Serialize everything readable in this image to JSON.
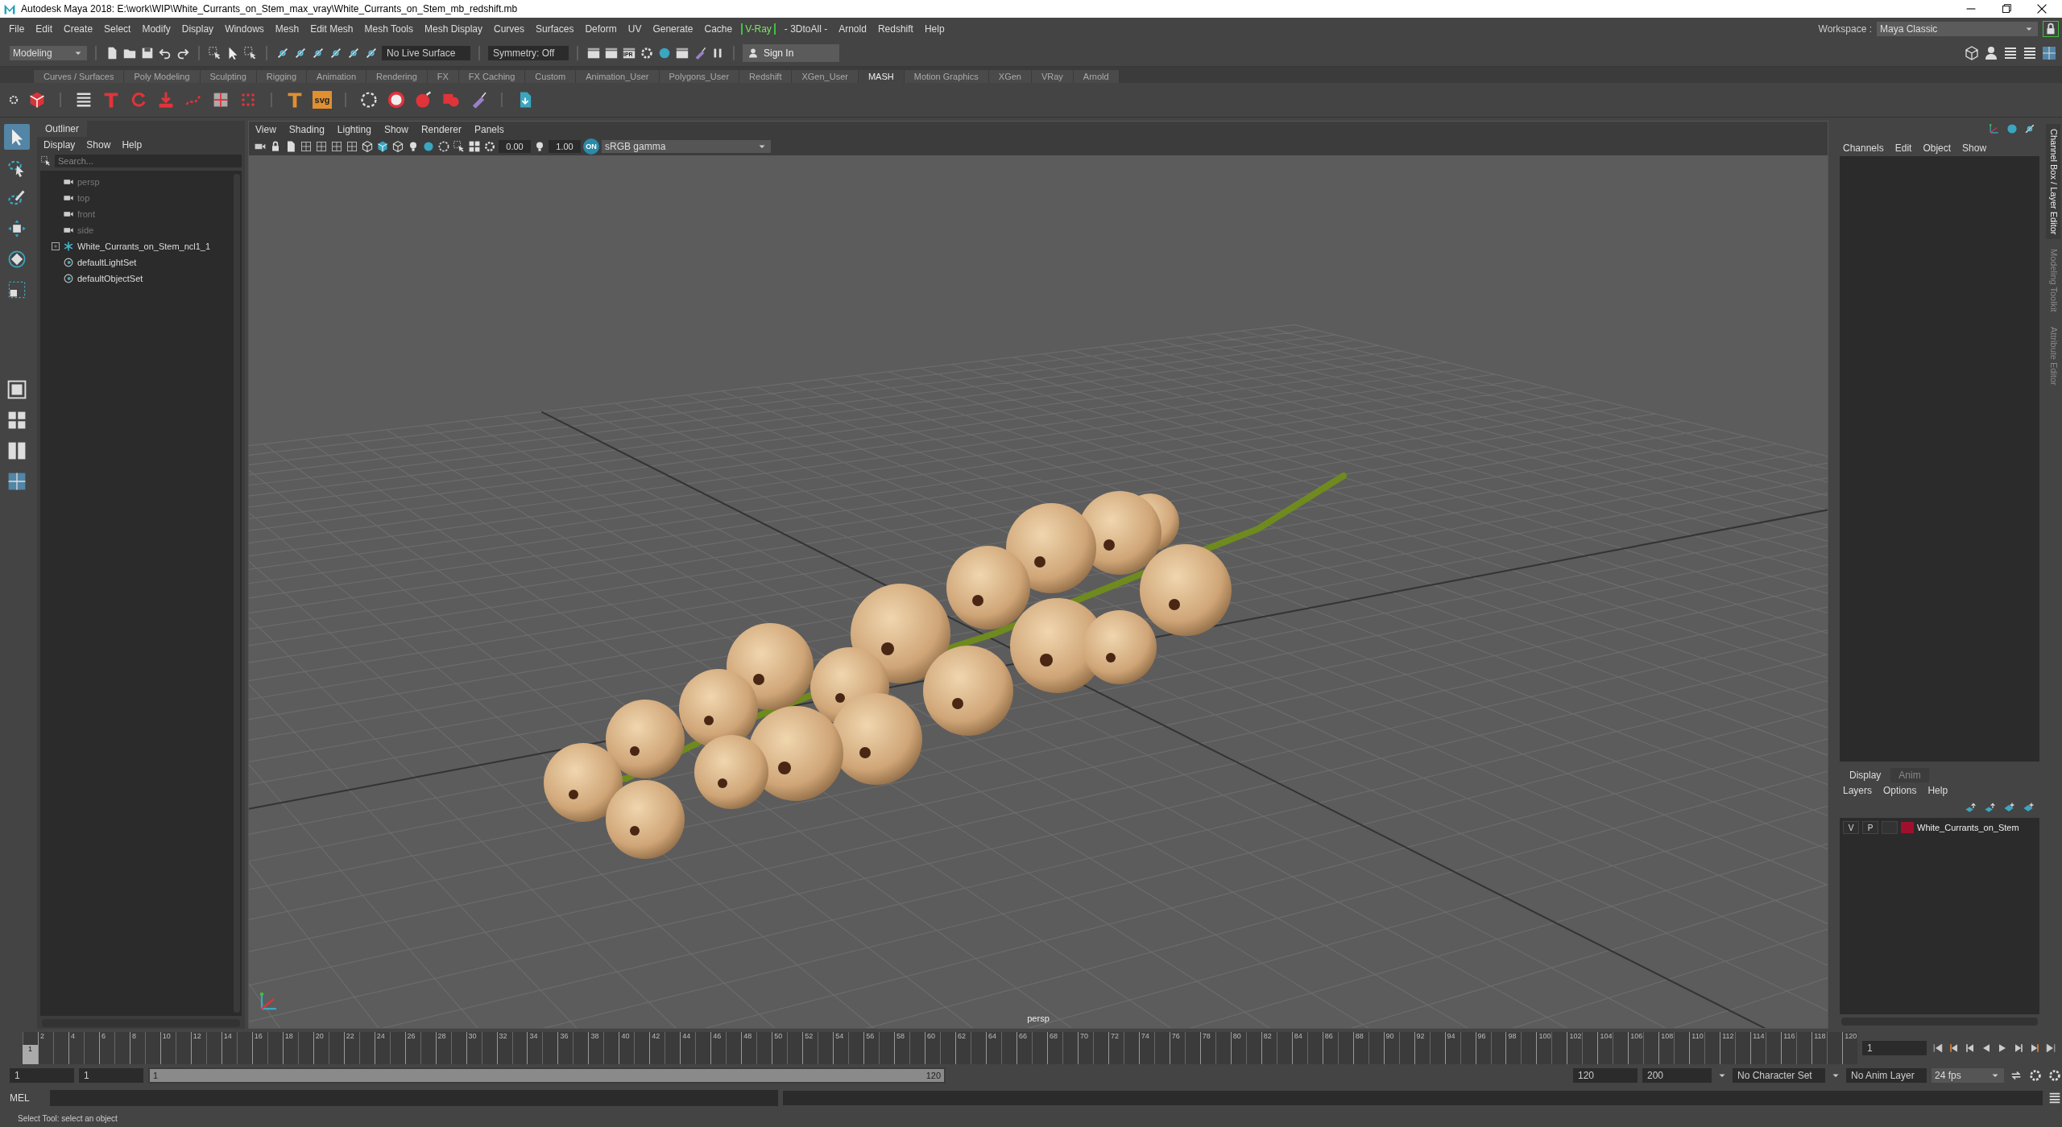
{
  "window": {
    "title": "Autodesk Maya 2018: E:\\work\\WIP\\White_Currants_on_Stem_max_vray\\White_Currants_on_Stem_mb_redshift.mb"
  },
  "menu_bar": {
    "items": [
      {
        "label": "File",
        "kind": "plain"
      },
      {
        "label": "Edit",
        "kind": "plain"
      },
      {
        "label": "Create",
        "kind": "plain"
      },
      {
        "label": "Select",
        "kind": "plain"
      },
      {
        "label": "Modify",
        "kind": "plain"
      },
      {
        "label": "Display",
        "kind": "plain"
      },
      {
        "label": "Windows",
        "kind": "plain"
      },
      {
        "label": "Mesh",
        "kind": "plain"
      },
      {
        "label": "Edit Mesh",
        "kind": "plain"
      },
      {
        "label": "Mesh Tools",
        "kind": "plain"
      },
      {
        "label": "Mesh Display",
        "kind": "plain"
      },
      {
        "label": "Curves",
        "kind": "plain"
      },
      {
        "label": "Surfaces",
        "kind": "plain"
      },
      {
        "label": "Deform",
        "kind": "plain"
      },
      {
        "label": "UV",
        "kind": "plain"
      },
      {
        "label": "Generate",
        "kind": "plain"
      },
      {
        "label": "Cache",
        "kind": "plain"
      },
      {
        "label": "V-Ray",
        "kind": "boxed"
      },
      {
        "label": "- 3DtoAll -",
        "kind": "plain"
      },
      {
        "label": "Arnold",
        "kind": "plain"
      },
      {
        "label": "Redshift",
        "kind": "plain"
      },
      {
        "label": "Help",
        "kind": "plain"
      }
    ],
    "workspace_label": "Workspace :",
    "workspace_value": "Maya Classic"
  },
  "status_line": {
    "mode": "Modeling",
    "live_surface": "No Live Surface",
    "symmetry": "Symmetry: Off",
    "ipr_label": "IPR",
    "sign_in": "Sign In"
  },
  "shelf": {
    "tabs": [
      {
        "label": "Curves / Surfaces",
        "selected": false
      },
      {
        "label": "Poly Modeling",
        "selected": false
      },
      {
        "label": "Sculpting",
        "selected": false
      },
      {
        "label": "Rigging",
        "selected": false
      },
      {
        "label": "Animation",
        "selected": false
      },
      {
        "label": "Rendering",
        "selected": false
      },
      {
        "label": "FX",
        "selected": false
      },
      {
        "label": "FX Caching",
        "selected": false
      },
      {
        "label": "Custom",
        "selected": false
      },
      {
        "label": "Animation_User",
        "selected": false
      },
      {
        "label": "Polygons_User",
        "selected": false
      },
      {
        "label": "Redshift",
        "selected": false
      },
      {
        "label": "XGen_User",
        "selected": false
      },
      {
        "label": "MASH",
        "selected": true
      },
      {
        "label": "Motion Graphics",
        "selected": false
      },
      {
        "label": "XGen",
        "selected": false
      },
      {
        "label": "VRay",
        "selected": false
      },
      {
        "label": "Arnold",
        "selected": false
      }
    ],
    "svg_icon_label": "svg"
  },
  "outliner": {
    "title": "Outliner",
    "menu": [
      "Display",
      "Show",
      "Help"
    ],
    "search": {
      "placeholder": "Search..."
    },
    "items": [
      {
        "label": "persp",
        "kind": "camera",
        "dimmed": true
      },
      {
        "label": "top",
        "kind": "camera",
        "dimmed": true
      },
      {
        "label": "front",
        "kind": "camera",
        "dimmed": true
      },
      {
        "label": "side",
        "kind": "camera",
        "dimmed": true
      },
      {
        "label": "White_Currants_on_Stem_ncl1_1",
        "kind": "transform",
        "dimmed": false,
        "expanded": false
      },
      {
        "label": "defaultLightSet",
        "kind": "set",
        "dimmed": false
      },
      {
        "label": "defaultObjectSet",
        "kind": "set",
        "dimmed": false
      }
    ]
  },
  "viewport": {
    "menu": [
      "View",
      "Shading",
      "Lighting",
      "Show",
      "Renderer",
      "Panels"
    ],
    "exposure": "0.00",
    "gamma": "1.00",
    "color_management": "ON",
    "color_space": "sRGB gamma",
    "camera_label": "persp"
  },
  "channel_box": {
    "menu": [
      "Channels",
      "Edit",
      "Object",
      "Show"
    ]
  },
  "side_tabs": [
    {
      "label": "Channel Box / Layer Editor",
      "selected": true
    },
    {
      "label": "Modeling Toolkit",
      "selected": false
    },
    {
      "label": "Attribute Editor",
      "selected": false
    }
  ],
  "layer_editor": {
    "tabs": [
      {
        "label": "Display",
        "selected": true
      },
      {
        "label": "Anim",
        "selected": false
      }
    ],
    "menu": [
      "Layers",
      "Options",
      "Help"
    ],
    "layers": [
      {
        "visibility": "V",
        "playback": "P",
        "name": "White_Currants_on_Stem",
        "color": "#a0102c"
      }
    ]
  },
  "time_slider": {
    "ticks": [
      "2",
      "4",
      "6",
      "8",
      "10",
      "12",
      "14",
      "16",
      "18",
      "20",
      "22",
      "24",
      "26",
      "28",
      "30",
      "32",
      "34",
      "36",
      "38",
      "40",
      "42",
      "44",
      "46",
      "48",
      "50",
      "52",
      "54",
      "56",
      "58",
      "60",
      "62",
      "64",
      "66",
      "68",
      "70",
      "72",
      "74",
      "76",
      "78",
      "80",
      "82",
      "84",
      "86",
      "88",
      "90",
      "92",
      "94",
      "96",
      "98",
      "100",
      "102",
      "104",
      "106",
      "108",
      "110",
      "112",
      "114",
      "116",
      "118",
      "120"
    ],
    "current_frame": "1",
    "level": 0,
    "frame_field": "1"
  },
  "range_slider": {
    "start": "1",
    "inner_start": "1",
    "range_start": "1",
    "range_end": "120",
    "level": 1,
    "inner_end": "120",
    "end": "200",
    "character_set": "No Character Set",
    "anim_layer": "No Anim Layer",
    "fps": "24 fps"
  },
  "command_line": {
    "label": "MEL"
  },
  "help_line": "Select Tool: select an object"
}
